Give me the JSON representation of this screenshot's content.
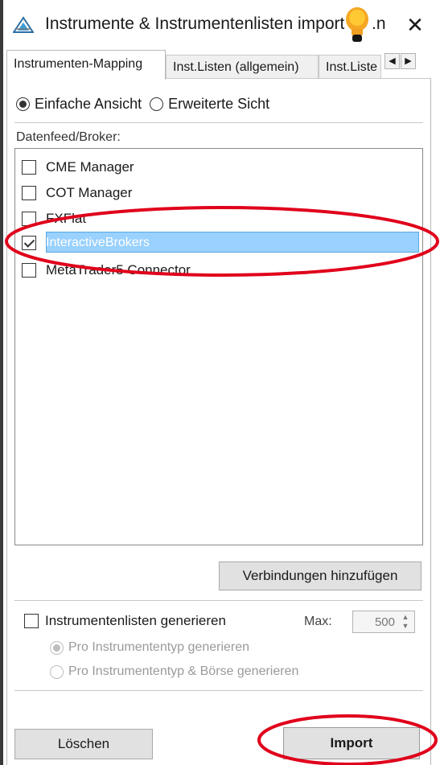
{
  "window": {
    "title": "Instrumente & Instrumentenlisten import",
    "title_tail": ".n",
    "close_label": "✕"
  },
  "tabs": [
    {
      "label": "Instrumenten-Mapping",
      "active": true
    },
    {
      "label": "Inst.Listen (allgemein)",
      "active": false
    },
    {
      "label": "Inst.Liste",
      "active": false
    }
  ],
  "tab_scroll": {
    "left": "◀",
    "right": "▶"
  },
  "view_mode": {
    "options": [
      "Einfache Ansicht",
      "Erweiterte Sicht"
    ],
    "selected": "Einfache Ansicht"
  },
  "broker_section": {
    "label": "Datenfeed/Broker:",
    "items": [
      {
        "label": "CME Manager",
        "checked": false,
        "selected": false
      },
      {
        "label": "COT Manager",
        "checked": false,
        "selected": false
      },
      {
        "label": "FXFlat",
        "checked": false,
        "selected": false
      },
      {
        "label": "InteractiveBrokers",
        "checked": true,
        "selected": true
      },
      {
        "label": "MetaTrader5 Connector",
        "checked": false,
        "selected": false
      }
    ]
  },
  "add_connections_button": "Verbindungen hinzufügen",
  "generate_lists": {
    "label": "Instrumentenlisten generieren",
    "checked": false,
    "max_label": "Max:",
    "max_value": "500",
    "options": [
      "Pro Instrumententyp generieren",
      "Pro Instrumententyp & Börse generieren"
    ],
    "selected": "Pro Instrumententyp generieren",
    "options_enabled": false
  },
  "footer": {
    "delete_button": "Löschen",
    "import_button": "Import"
  },
  "annotation_color": "#e0001b"
}
